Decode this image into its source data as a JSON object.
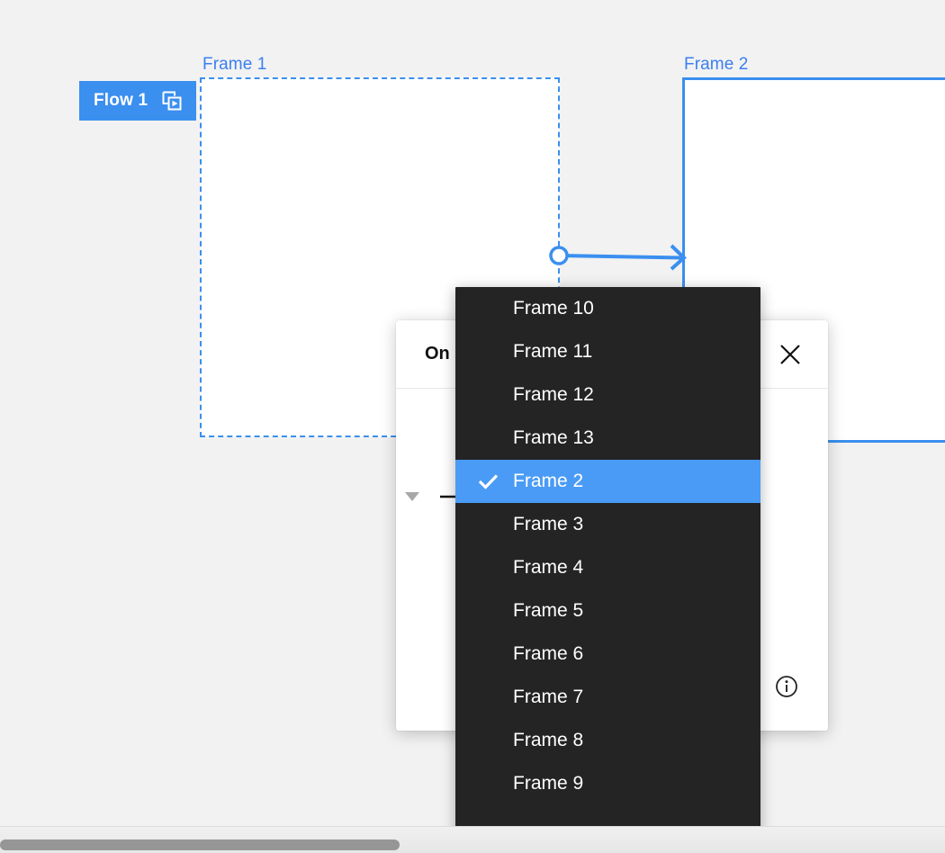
{
  "canvas": {
    "background_color": "#f2f2f2",
    "accent_color": "#3b8fef",
    "flow_badge": {
      "label": "Flow 1",
      "icon": "play-frame-icon"
    },
    "frames": [
      {
        "label": "Frame 1",
        "state": "dashed-outline"
      },
      {
        "label": "Frame 2",
        "state": "selected-solid-outline"
      }
    ],
    "connector": {
      "from": "Frame 1",
      "to": "Frame 2",
      "handle_icon": "circle-handle-icon",
      "arrow_icon": "arrow-head-icon"
    }
  },
  "dialog": {
    "title": "On",
    "close_icon": "close-icon",
    "trigger_caret_icon": "chevron-down-icon",
    "action_arrow_icon": "arrow-right-icon",
    "info_icon": "info-icon"
  },
  "dropdown": {
    "background_color": "#242424",
    "highlight_color": "#4a9bf5",
    "selected": "Frame 2",
    "check_icon": "check-icon",
    "scroll_more_icon": "chevron-down-icon",
    "options": [
      "Frame 10",
      "Frame 11",
      "Frame 12",
      "Frame 13",
      "Frame 2",
      "Frame 3",
      "Frame 4",
      "Frame 5",
      "Frame 6",
      "Frame 7",
      "Frame 8",
      "Frame 9"
    ]
  },
  "bottom_bar": {
    "scrollbar": "horizontal-scrollbar"
  }
}
